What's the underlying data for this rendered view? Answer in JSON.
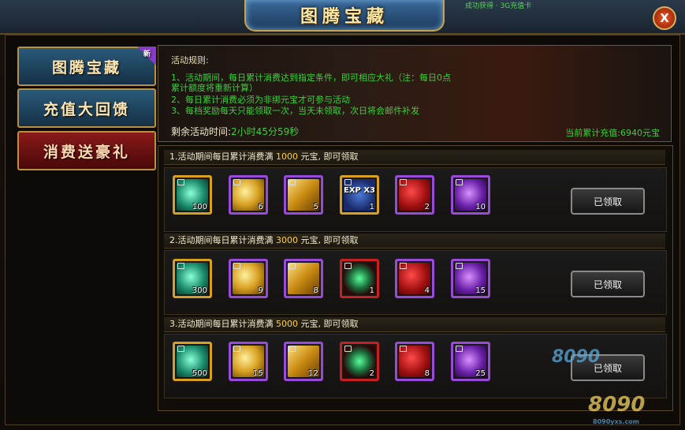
{
  "window": {
    "title": "图腾宝藏",
    "close_label": "X",
    "top_deco": "成功获得 · 3G充值卡"
  },
  "sidebar": {
    "items": [
      {
        "label": "图腾宝藏",
        "badge": "新"
      },
      {
        "label": "充值大回馈"
      },
      {
        "label": "消费送豪礼",
        "active": true
      }
    ]
  },
  "info": {
    "rules_title": "活动规则:",
    "rules": [
      "1、活动期间，每日累计消费达到指定条件，即可相应大礼（注：每日0点",
      "累计额度将重新计算）",
      "2、每日累计消费必须为非绑元宝才可参与活动",
      "3、每档奖励每天只能领取一次，当天未领取，次日将会邮件补发"
    ],
    "remaining_label": "剩余活动时间:",
    "remaining_value": "2小时45分59秒",
    "total_recharge": "当前累计充值:6940元宝"
  },
  "tiers": [
    {
      "prefix": "1.活动期间每日累计消费满 ",
      "amount": "1000",
      "suffix": " 元宝, 即可领取",
      "claim_label": "已领取",
      "items": [
        {
          "icon": "green-crystal-icon",
          "qty": "100"
        },
        {
          "icon": "gold-ore-icon",
          "qty": "6"
        },
        {
          "icon": "gold-ticket-icon",
          "qty": "5"
        },
        {
          "icon": "exp-x3-icon",
          "qty": "1",
          "text": "EXP X3"
        },
        {
          "icon": "red-rose-icon",
          "qty": "2"
        },
        {
          "icon": "purple-crystal-icon",
          "qty": "10"
        }
      ]
    },
    {
      "prefix": "2.活动期间每日累计消费满 ",
      "amount": "3000",
      "suffix": " 元宝, 即可领取",
      "claim_label": "已领取",
      "items": [
        {
          "icon": "green-crystal-icon",
          "qty": "300"
        },
        {
          "icon": "gold-ore-icon",
          "qty": "9"
        },
        {
          "icon": "gold-ticket-icon",
          "qty": "8"
        },
        {
          "icon": "green-orb-icon",
          "qty": "1"
        },
        {
          "icon": "red-rose-icon",
          "qty": "4"
        },
        {
          "icon": "purple-crystal-icon",
          "qty": "15"
        }
      ]
    },
    {
      "prefix": "3.活动期间每日累计消费满 ",
      "amount": "5000",
      "suffix": " 元宝, 即可领取",
      "claim_label": "已领取",
      "items": [
        {
          "icon": "green-crystal-icon",
          "qty": "500"
        },
        {
          "icon": "gold-ore-icon",
          "qty": "15"
        },
        {
          "icon": "gold-ticket-icon",
          "qty": "12"
        },
        {
          "icon": "green-orb-icon",
          "qty": "2"
        },
        {
          "icon": "red-rose-icon",
          "qty": "8"
        },
        {
          "icon": "purple-crystal-icon",
          "qty": "25"
        }
      ]
    }
  ],
  "watermark": {
    "brand": "8090",
    "site": "8090yxs.com"
  }
}
